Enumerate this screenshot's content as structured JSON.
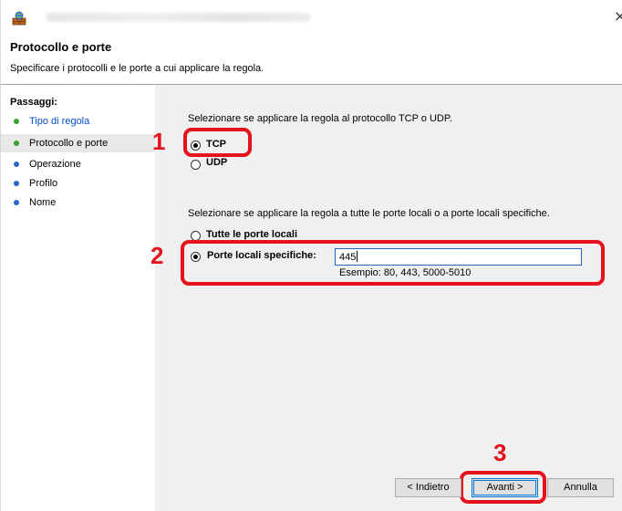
{
  "window": {
    "close_symbol": "×",
    "header_title": "Protocollo e porte",
    "header_subtitle": "Specificare i protocolli e le porte a cui applicare la regola."
  },
  "sidebar": {
    "title": "Passaggi:",
    "items": [
      {
        "label": "Tipo di regola",
        "state": "done"
      },
      {
        "label": "Protocollo e porte",
        "state": "active"
      },
      {
        "label": "Operazione",
        "state": "todo"
      },
      {
        "label": "Profilo",
        "state": "todo"
      },
      {
        "label": "Nome",
        "state": "todo"
      }
    ]
  },
  "protocol": {
    "prompt": "Selezionare se applicare la regola al protocollo TCP o UDP.",
    "options": [
      {
        "label": "TCP",
        "selected": true
      },
      {
        "label": "UDP",
        "selected": false
      }
    ]
  },
  "ports": {
    "prompt": "Selezionare se applicare la regola a tutte le porte locali o a porte locali specifiche.",
    "options": [
      {
        "label": "Tutte le porte locali",
        "selected": false
      },
      {
        "label": "Porte locali specifiche:",
        "selected": true
      }
    ],
    "input_value": "445",
    "example": "Esempio: 80, 443, 5000-5010"
  },
  "annotations": {
    "step1": "1",
    "step2": "2",
    "step3": "3",
    "color": "#e3121c"
  },
  "buttons": {
    "back": "< Indietro",
    "next": "Avanti >",
    "cancel": "Annulla"
  }
}
